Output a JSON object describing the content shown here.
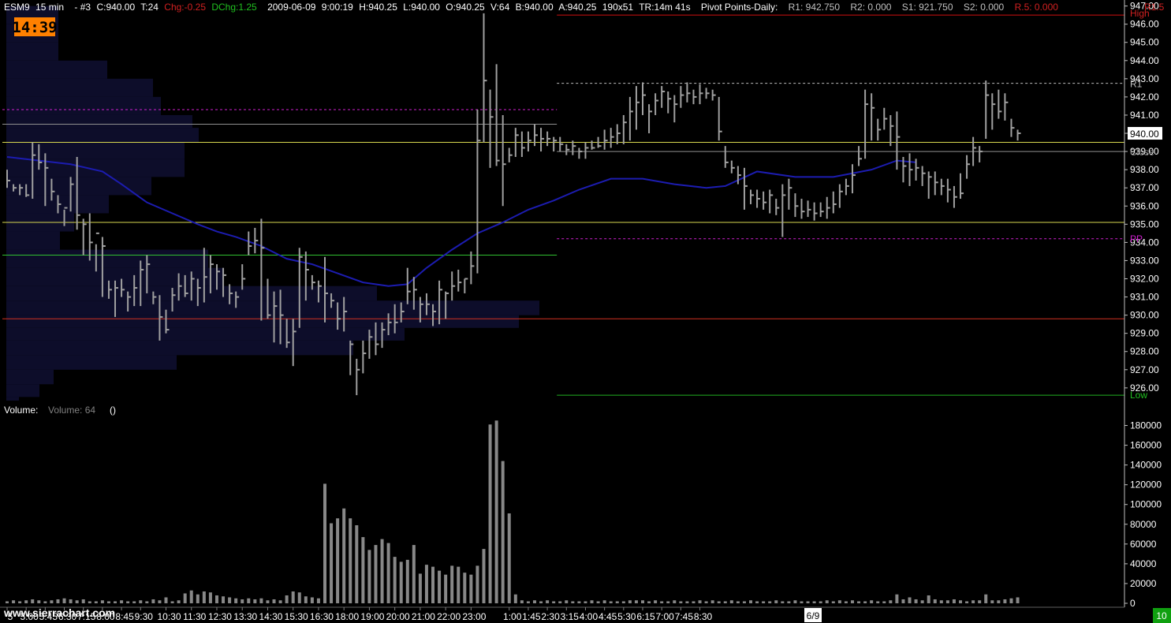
{
  "header": {
    "symbol": "ESM9",
    "interval": "15 min",
    "chart_no": "- #3",
    "close": "C:940.00",
    "trades": "T:24",
    "chg": "Chg:-0.25",
    "dchg": "DChg:1.25",
    "date": "2009-06-09",
    "time": "9:00:19",
    "high": "H:940.25",
    "low": "L:940.00",
    "open": "O:940.25",
    "volume": "V:64",
    "bid": "B:940.00",
    "ask": "A:940.25",
    "size": "190x51",
    "timer": "TR:14m 41s",
    "pivot_title": "Pivot Points-Daily:",
    "r1": "R1: 942.750",
    "r2": "R2: 0.000",
    "s1": "S1: 921.750",
    "s2": "S2: 0.000",
    "r5": "R.5: 0.000",
    "r15": "R1.5"
  },
  "clock": "14:39",
  "volume_label": "Volume:",
  "volume_value": "Volume: 64",
  "volume_parens": "()",
  "watermark": "www.sierrachart.com",
  "date_marker": "6/9",
  "corner_badge": "10",
  "colors": {
    "bar": "#a0a0a0",
    "ma": "#1c1cb0",
    "profile": "#0d0d2a",
    "pivot": "#d020d0",
    "high_line": "#d01010",
    "low_line": "#20b020",
    "yellow": "#d8d850",
    "green": "#30c030",
    "red": "#d03020",
    "grey": "#909090",
    "clock_bg": "#ff8000",
    "chg_neg": "#d02020",
    "chg_pos": "#20c020"
  },
  "chart_data": {
    "type": "bar",
    "price_ticks": [
      "947.00",
      "946.00",
      "945.00",
      "944.00",
      "943.00",
      "942.00",
      "941.00",
      "940.00",
      "939.00",
      "938.00",
      "937.00",
      "936.00",
      "935.00",
      "934.00",
      "933.00",
      "932.00",
      "931.00",
      "930.00",
      "929.00",
      "928.00",
      "927.00",
      "926.00"
    ],
    "price_tick_values": [
      947,
      946,
      945,
      944,
      943,
      942,
      941,
      940,
      939,
      938,
      937,
      936,
      935,
      934,
      933,
      932,
      931,
      930,
      929,
      928,
      927,
      926
    ],
    "price_range": [
      925.3,
      947.2
    ],
    "volume_ticks": [
      "180000",
      "160000",
      "140000",
      "120000",
      "100000",
      "80000",
      "60000",
      "40000",
      "20000",
      "0"
    ],
    "volume_tick_values": [
      180000,
      160000,
      140000,
      120000,
      100000,
      80000,
      60000,
      40000,
      20000,
      0
    ],
    "volume_range": [
      0,
      190000
    ],
    "time_labels": [
      "5",
      "5:00",
      "5:45",
      "6:30",
      "7:15",
      "8:00",
      "8:45",
      "9:30",
      "10:30",
      "11:30",
      "12:30",
      "13:30",
      "14:30",
      "15:30",
      "16:30",
      "18:00",
      "19:00",
      "20:00",
      "21:00",
      "22:00",
      "23:00",
      "1:00",
      "1:45",
      "2:30",
      "3:15",
      "4:00",
      "4:45",
      "5:30",
      "6:15",
      "7:00",
      "7:45",
      "8:30"
    ],
    "time_label_index": [
      0,
      3,
      6,
      9,
      12,
      15,
      18,
      21,
      25,
      29,
      33,
      37,
      41,
      45,
      49,
      53,
      57,
      61,
      65,
      69,
      73,
      79,
      82,
      85,
      88,
      91,
      94,
      97,
      100,
      103,
      106,
      109
    ],
    "price_labels": {
      "r1": "R1",
      "last": "940.00",
      "close": "Close",
      "pp": "PP",
      "high": "High",
      "low": "Low"
    },
    "levels": {
      "high": 946.5,
      "r1": 942.75,
      "pp": 934.2,
      "low": 925.6,
      "close": 939.0,
      "last": 940.0,
      "prev_pivot": 941.3,
      "prev_grey": 940.5,
      "yellow_1": 939.5,
      "yellow_2": 935.1,
      "green": 933.3,
      "red": 929.8
    },
    "bars": [
      [
        938.0,
        937.4,
        937.0
      ],
      [
        937.2,
        937.0,
        936.8
      ],
      [
        937.2,
        937.0,
        936.6
      ],
      [
        937.2,
        936.6,
        936.5
      ],
      [
        939.5,
        938.8,
        936.4
      ],
      [
        939.4,
        938.4,
        938.0
      ],
      [
        938.9,
        938.1,
        936.0
      ],
      [
        937.5,
        936.8,
        936.3
      ],
      [
        936.6,
        936.1,
        935.6
      ],
      [
        935.8,
        935.9,
        934.9
      ],
      [
        937.6,
        937.2,
        935.7
      ],
      [
        938.7,
        935.5,
        934.7
      ],
      [
        935.3,
        935.0,
        933.3
      ],
      [
        935.6,
        934.0,
        933.0
      ],
      [
        933.9,
        934.5,
        932.4
      ],
      [
        934.3,
        933.8,
        931.0
      ],
      [
        931.9,
        931.4,
        930.9
      ],
      [
        931.9,
        931.5,
        929.9
      ],
      [
        932.0,
        931.4,
        931.0
      ],
      [
        931.3,
        931.0,
        930.2
      ],
      [
        932.2,
        931.5,
        930.5
      ],
      [
        933.0,
        932.5,
        930.5
      ],
      [
        933.3,
        932.8,
        931.2
      ],
      [
        931.3,
        931.0,
        930.6
      ],
      [
        931.1,
        929.9,
        928.6
      ],
      [
        930.3,
        929.2,
        929.0
      ],
      [
        931.5,
        931.1,
        930.2
      ],
      [
        932.3,
        931.6,
        930.8
      ],
      [
        932.2,
        931.2,
        931.0
      ],
      [
        932.4,
        932.0,
        930.8
      ],
      [
        932.0,
        931.5,
        930.5
      ],
      [
        933.7,
        932.1,
        930.7
      ],
      [
        933.3,
        932.8,
        931.2
      ],
      [
        932.8,
        932.4,
        931.4
      ],
      [
        932.6,
        932.2,
        931.0
      ],
      [
        931.7,
        931.2,
        930.6
      ],
      [
        931.3,
        931.0,
        930.4
      ],
      [
        932.8,
        932.0,
        931.4
      ],
      [
        934.6,
        933.8,
        933.3
      ],
      [
        934.8,
        934.1,
        933.4
      ],
      [
        935.3,
        933.7,
        929.7
      ],
      [
        932.0,
        930.0,
        929.8
      ],
      [
        931.3,
        930.5,
        928.5
      ],
      [
        931.4,
        930.0,
        928.4
      ],
      [
        929.8,
        928.5,
        928.2
      ],
      [
        929.8,
        929.1,
        927.2
      ],
      [
        933.7,
        933.2,
        929.3
      ],
      [
        933.5,
        932.5,
        930.8
      ],
      [
        932.2,
        931.8,
        931.4
      ],
      [
        931.9,
        931.6,
        930.7
      ],
      [
        933.2,
        931.2,
        929.6
      ],
      [
        931.2,
        930.8,
        930.4
      ],
      [
        930.7,
        929.8,
        929.2
      ],
      [
        931.0,
        930.2,
        929.1
      ],
      [
        928.6,
        928.4,
        926.7
      ],
      [
        927.6,
        927.0,
        925.6
      ],
      [
        928.6,
        927.9,
        926.8
      ],
      [
        929.2,
        928.8,
        927.6
      ],
      [
        929.6,
        928.4,
        927.8
      ],
      [
        929.6,
        929.2,
        928.2
      ],
      [
        930.1,
        929.6,
        928.9
      ],
      [
        930.6,
        929.6,
        929.0
      ],
      [
        930.7,
        930.2,
        929.6
      ],
      [
        932.6,
        931.3,
        930.6
      ],
      [
        932.1,
        931.4,
        930.3
      ],
      [
        931.0,
        930.6,
        929.6
      ],
      [
        931.2,
        930.6,
        930.0
      ],
      [
        930.6,
        930.2,
        929.4
      ],
      [
        931.9,
        931.4,
        929.5
      ],
      [
        931.3,
        931.2,
        929.8
      ],
      [
        932.4,
        931.6,
        930.8
      ],
      [
        932.5,
        931.8,
        931.3
      ],
      [
        932.0,
        932.0,
        931.2
      ],
      [
        933.5,
        932.7,
        931.7
      ],
      [
        941.3,
        939.6,
        932.3
      ],
      [
        946.6,
        942.9,
        939.5
      ],
      [
        942.4,
        940.9,
        938.1
      ],
      [
        943.8,
        938.5,
        938.2
      ],
      [
        941.0,
        938.3,
        936.0
      ],
      [
        939.2,
        938.8,
        938.4
      ],
      [
        940.3,
        939.9,
        938.7
      ],
      [
        940.1,
        939.2,
        938.7
      ],
      [
        940.1,
        939.6,
        939.0
      ],
      [
        940.5,
        939.9,
        939.3
      ],
      [
        940.3,
        939.7,
        939.0
      ],
      [
        940.1,
        939.7,
        939.3
      ],
      [
        939.8,
        939.6,
        939.0
      ],
      [
        939.8,
        939.4,
        939.0
      ],
      [
        939.4,
        939.1,
        938.8
      ],
      [
        939.6,
        939.3,
        938.8
      ],
      [
        939.2,
        939.0,
        938.6
      ],
      [
        939.5,
        939.2,
        938.6
      ],
      [
        939.6,
        939.2,
        939.1
      ],
      [
        939.8,
        939.3,
        939.2
      ],
      [
        940.2,
        939.6,
        939.1
      ],
      [
        940.3,
        939.8,
        939.2
      ],
      [
        940.5,
        940.0,
        939.4
      ],
      [
        941.0,
        940.6,
        939.4
      ],
      [
        942.0,
        941.2,
        939.6
      ],
      [
        942.6,
        941.7,
        940.2
      ],
      [
        942.8,
        942.1,
        941.0
      ],
      [
        941.6,
        941.2,
        940.0
      ],
      [
        942.2,
        941.8,
        941.0
      ],
      [
        942.6,
        942.3,
        941.4
      ],
      [
        942.3,
        941.9,
        941.1
      ],
      [
        942.1,
        941.6,
        940.6
      ],
      [
        942.6,
        942.1,
        941.4
      ],
      [
        942.8,
        942.2,
        941.7
      ],
      [
        942.4,
        942.0,
        941.6
      ],
      [
        942.7,
        942.2,
        941.6
      ],
      [
        942.5,
        942.2,
        941.9
      ],
      [
        942.4,
        942.1,
        941.8
      ],
      [
        942.0,
        940.1,
        939.6
      ],
      [
        939.3,
        938.4,
        938.1
      ],
      [
        938.5,
        938.1,
        937.8
      ],
      [
        938.2,
        937.7,
        937.2
      ],
      [
        938.1,
        937.1,
        935.8
      ],
      [
        936.9,
        936.6,
        936.1
      ],
      [
        936.9,
        936.4,
        935.9
      ],
      [
        936.8,
        936.2,
        935.8
      ],
      [
        936.9,
        936.6,
        935.6
      ],
      [
        936.4,
        935.9,
        935.5
      ],
      [
        937.2,
        936.6,
        934.3
      ],
      [
        937.5,
        937.0,
        935.8
      ],
      [
        936.7,
        936.0,
        935.4
      ],
      [
        936.4,
        935.7,
        935.3
      ],
      [
        936.3,
        935.8,
        935.4
      ],
      [
        936.2,
        935.6,
        935.2
      ],
      [
        936.2,
        935.7,
        935.4
      ],
      [
        936.5,
        935.9,
        935.3
      ],
      [
        936.8,
        936.1,
        935.6
      ],
      [
        937.2,
        936.8,
        935.9
      ],
      [
        937.5,
        937.1,
        936.6
      ],
      [
        938.3,
        937.7,
        936.7
      ],
      [
        939.3,
        938.6,
        938.2
      ],
      [
        942.4,
        941.6,
        938.6
      ],
      [
        942.2,
        941.4,
        939.6
      ],
      [
        940.8,
        940.2,
        939.6
      ],
      [
        941.4,
        940.8,
        940.2
      ],
      [
        941.0,
        940.4,
        939.3
      ],
      [
        941.2,
        939.8,
        938.0
      ],
      [
        938.7,
        938.2,
        937.3
      ],
      [
        938.9,
        938.0,
        937.1
      ],
      [
        938.6,
        938.1,
        937.4
      ],
      [
        938.2,
        937.8,
        937.1
      ],
      [
        937.9,
        937.6,
        936.4
      ],
      [
        937.9,
        937.3,
        936.6
      ],
      [
        937.5,
        937.1,
        936.6
      ],
      [
        937.5,
        936.9,
        936.2
      ],
      [
        937.1,
        936.5,
        935.9
      ],
      [
        937.8,
        936.7,
        936.4
      ],
      [
        938.8,
        938.3,
        937.5
      ],
      [
        939.8,
        939.2,
        938.2
      ],
      [
        939.3,
        939.0,
        938.4
      ],
      [
        942.9,
        942.1,
        939.7
      ],
      [
        942.2,
        941.6,
        940.2
      ],
      [
        942.4,
        941.2,
        940.8
      ],
      [
        942.2,
        941.7,
        940.7
      ],
      [
        940.8,
        940.3,
        939.8
      ],
      [
        940.2,
        940.0,
        939.6
      ]
    ],
    "ma": [
      [
        0,
        938.7
      ],
      [
        5,
        938.5
      ],
      [
        10,
        938.3
      ],
      [
        15,
        937.9
      ],
      [
        18,
        937.2
      ],
      [
        22,
        936.2
      ],
      [
        26,
        935.6
      ],
      [
        30,
        935.0
      ],
      [
        33,
        934.6
      ],
      [
        36,
        934.3
      ],
      [
        40,
        933.8
      ],
      [
        44,
        933.1
      ],
      [
        48,
        932.8
      ],
      [
        52,
        932.3
      ],
      [
        56,
        931.8
      ],
      [
        60,
        931.6
      ],
      [
        63,
        931.7
      ],
      [
        66,
        932.6
      ],
      [
        70,
        933.6
      ],
      [
        74,
        934.5
      ],
      [
        78,
        935.1
      ],
      [
        82,
        935.8
      ],
      [
        86,
        936.3
      ],
      [
        90,
        936.9
      ],
      [
        95,
        937.5
      ],
      [
        100,
        937.5
      ],
      [
        105,
        937.2
      ],
      [
        110,
        937.0
      ],
      [
        113,
        937.1
      ],
      [
        118,
        937.9
      ],
      [
        124,
        937.6
      ],
      [
        130,
        937.6
      ],
      [
        136,
        938.0
      ],
      [
        140,
        938.5
      ],
      [
        143,
        938.4
      ]
    ],
    "volume": [
      2000,
      3000,
      2000,
      3000,
      4000,
      3000,
      2000,
      3000,
      4000,
      5000,
      4000,
      3000,
      4000,
      2000,
      2000,
      3000,
      2000,
      2000,
      3000,
      2000,
      2000,
      3000,
      2000,
      4000,
      3000,
      6000,
      2000,
      3000,
      10000,
      13000,
      9000,
      12000,
      11000,
      8000,
      7000,
      6000,
      5000,
      4000,
      5000,
      4000,
      5000,
      3000,
      4000,
      3000,
      8000,
      12000,
      11000,
      7000,
      6000,
      5000,
      121000,
      81000,
      86000,
      96000,
      86000,
      79000,
      67000,
      54000,
      59000,
      65000,
      61000,
      47000,
      42000,
      44000,
      59000,
      30000,
      39000,
      37000,
      33000,
      29000,
      38000,
      37000,
      31000,
      29000,
      38000,
      55000,
      181000,
      185000,
      144000,
      91000,
      9000,
      3000,
      2000,
      3000,
      2000,
      3000,
      2000,
      2000,
      3000,
      2000,
      2000,
      2000,
      3000,
      2000,
      3000,
      2000,
      2000,
      2000,
      3000,
      3000,
      3000,
      2000,
      3000,
      2000,
      2000,
      3000,
      2000,
      2000,
      2000,
      3000,
      2000,
      3000,
      2000,
      2000,
      3000,
      2000,
      2000,
      3000,
      2000,
      2000,
      2000,
      3000,
      2000,
      2000,
      3000,
      2000,
      2000,
      2000,
      2000,
      3000,
      2000,
      3000,
      2000,
      3000,
      2000,
      2000,
      3000,
      2000,
      2000,
      3000,
      9000,
      4000,
      6000,
      4000,
      3000,
      8000,
      4000,
      3000,
      3000,
      4000,
      3000,
      2000,
      3000,
      3000,
      9000,
      3000,
      3000,
      4000,
      5000,
      6000
    ],
    "profile": [
      [
        947.0,
        66
      ],
      [
        946.0,
        66
      ],
      [
        945.0,
        66
      ],
      [
        944.0,
        128
      ],
      [
        943.0,
        186
      ],
      [
        942.0,
        196
      ],
      [
        941.0,
        236
      ],
      [
        940.3,
        244
      ],
      [
        939.5,
        226
      ],
      [
        938.6,
        226
      ],
      [
        937.6,
        184
      ],
      [
        936.6,
        130
      ],
      [
        935.6,
        86
      ],
      [
        934.6,
        68
      ],
      [
        933.6,
        256
      ],
      [
        932.6,
        276
      ],
      [
        931.6,
        470
      ],
      [
        930.8,
        676
      ],
      [
        930.0,
        650
      ],
      [
        929.3,
        505
      ],
      [
        928.6,
        440
      ],
      [
        927.8,
        216
      ],
      [
        927.0,
        60
      ],
      [
        926.2,
        42
      ],
      [
        925.5,
        16
      ]
    ]
  }
}
